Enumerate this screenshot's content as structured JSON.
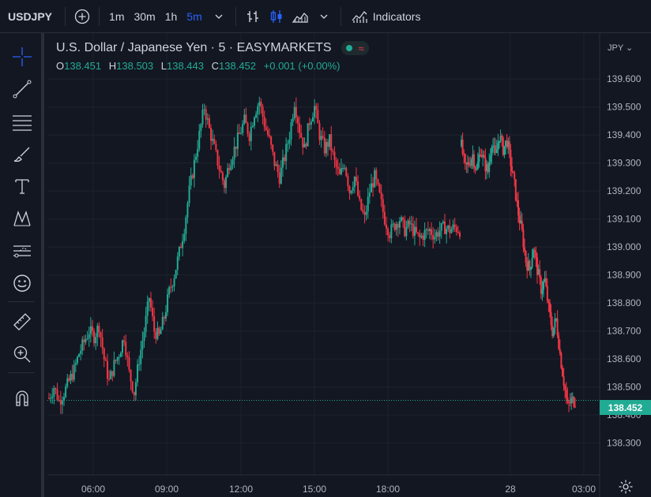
{
  "toolbar": {
    "symbol": "USDJPY",
    "intervals": [
      "1m",
      "30m",
      "1h",
      "5m"
    ],
    "active_interval": "5m",
    "indicators_label": "Indicators"
  },
  "left_tools": [
    "crosshair-icon",
    "trend-line-icon",
    "horizontal-lines-icon",
    "brush-icon",
    "text-icon",
    "pattern-icon",
    "prediction-icon",
    "emoji-icon",
    "ruler-icon",
    "zoom-in-icon",
    "magnet-icon"
  ],
  "legend": {
    "title": "U.S. Dollar / Japanese Yen · 5 · EASYMARKETS",
    "o_label": "O",
    "o_value": "138.451",
    "h_label": "H",
    "h_value": "138.503",
    "l_label": "L",
    "l_value": "138.443",
    "c_label": "C",
    "c_value": "138.452",
    "change": "+0.001 (+0.00%)"
  },
  "price_axis": {
    "currency": "JPY",
    "ticks": [
      "139.600",
      "139.500",
      "139.400",
      "139.300",
      "139.200",
      "139.100",
      "139.000",
      "138.900",
      "138.800",
      "138.700",
      "138.600",
      "138.500",
      "138.400",
      "138.300"
    ],
    "current_price": "138.452"
  },
  "time_axis": {
    "ticks": [
      "06:00",
      "09:00",
      "12:00",
      "15:00",
      "18:00",
      "28",
      "03:00"
    ]
  },
  "colors": {
    "up": "#22ab94",
    "down": "#f23645",
    "background": "#131722",
    "grid": "#1e222d",
    "accent": "#2962ff"
  },
  "chart_data": {
    "type": "candlestick",
    "symbol": "USDJPY",
    "timeframe": "5",
    "ylim": [
      138.25,
      139.65
    ],
    "y_ticks": [
      139.6,
      139.5,
      139.4,
      139.3,
      139.2,
      139.1,
      139.0,
      138.9,
      138.8,
      138.7,
      138.6,
      138.5,
      138.4,
      138.3
    ],
    "x_ticks": [
      "06:00",
      "09:00",
      "12:00",
      "15:00",
      "18:00",
      "28",
      "03:00"
    ],
    "segments": [
      {
        "session": "day1",
        "path": [
          [
            138.46,
            138.43
          ],
          [
            138.5,
            138.42
          ],
          [
            138.45,
            138.48
          ],
          [
            138.48,
            138.46
          ],
          [
            138.52,
            138.49
          ],
          [
            138.56,
            138.54
          ],
          [
            138.62,
            138.6
          ],
          [
            138.66,
            138.64
          ],
          [
            138.7,
            138.62
          ],
          [
            138.68,
            138.66
          ],
          [
            138.72,
            138.7
          ],
          [
            138.6,
            138.55
          ],
          [
            138.52,
            138.5
          ],
          [
            138.58,
            138.56
          ],
          [
            138.62,
            138.6
          ],
          [
            138.68,
            138.66
          ],
          [
            138.55,
            138.52
          ],
          [
            138.48,
            138.46
          ],
          [
            138.6,
            138.58
          ],
          [
            138.7,
            138.68
          ],
          [
            138.82,
            138.8
          ],
          [
            138.7,
            138.65
          ],
          [
            138.68,
            138.66
          ],
          [
            138.75,
            138.72
          ],
          [
            138.84,
            138.8
          ],
          [
            138.9,
            138.85
          ],
          [
            138.98,
            138.95
          ],
          [
            139.07,
            139.05
          ],
          [
            139.2,
            139.1
          ],
          [
            139.3,
            139.26
          ],
          [
            139.4,
            139.38
          ],
          [
            139.5,
            139.45
          ],
          [
            139.42,
            139.4
          ],
          [
            139.35,
            139.32
          ],
          [
            139.28,
            139.25
          ],
          [
            139.22,
            139.2
          ],
          [
            139.3,
            139.28
          ],
          [
            139.35,
            139.33
          ],
          [
            139.4,
            139.38
          ],
          [
            139.45,
            139.42
          ],
          [
            139.4,
            139.38
          ],
          [
            139.48,
            139.45
          ],
          [
            139.52,
            139.5
          ],
          [
            139.44,
            139.4
          ],
          [
            139.38,
            139.35
          ],
          [
            139.3,
            139.28
          ],
          [
            139.25,
            139.22
          ],
          [
            139.32,
            139.3
          ],
          [
            139.4,
            139.36
          ],
          [
            139.52,
            139.48
          ],
          [
            139.42,
            139.4
          ],
          [
            139.35,
            139.32
          ],
          [
            139.45,
            139.4
          ],
          [
            139.5,
            139.48
          ],
          [
            139.4,
            139.38
          ],
          [
            139.35,
            139.32
          ],
          [
            139.38,
            139.35
          ],
          [
            139.3,
            139.28
          ],
          [
            139.25,
            139.22
          ],
          [
            139.3,
            139.28
          ],
          [
            139.2,
            139.18
          ],
          [
            139.25,
            139.22
          ],
          [
            139.15,
            139.12
          ],
          [
            139.1,
            139.08
          ],
          [
            139.2,
            139.18
          ],
          [
            139.25,
            139.22
          ],
          [
            139.18,
            139.15
          ],
          [
            139.1,
            139.08
          ],
          [
            139.05,
            139.03
          ],
          [
            139.08,
            139.06
          ],
          [
            139.1,
            139.08
          ],
          [
            139.06,
            139.04
          ],
          [
            139.08,
            139.06
          ],
          [
            139.05,
            139.03
          ],
          [
            139.03,
            139.02
          ],
          [
            139.05,
            139.04
          ],
          [
            139.06,
            139.05
          ],
          [
            139.04,
            139.03
          ],
          [
            139.06,
            139.05
          ],
          [
            139.07,
            139.06
          ],
          [
            139.06,
            139.05
          ],
          [
            139.07,
            139.06
          ],
          [
            139.06,
            139.06
          ]
        ]
      },
      {
        "session": "day2",
        "path": [
          [
            139.36,
            139.35
          ],
          [
            139.28,
            139.27
          ],
          [
            139.3,
            139.28
          ],
          [
            139.33,
            139.31
          ],
          [
            139.27,
            139.28
          ],
          [
            139.35,
            139.33
          ],
          [
            139.3,
            139.29
          ],
          [
            139.27,
            139.28
          ],
          [
            139.38,
            139.36
          ],
          [
            139.32,
            139.3
          ],
          [
            139.4,
            139.38
          ],
          [
            139.35,
            139.33
          ],
          [
            139.38,
            139.36
          ],
          [
            139.3,
            139.28
          ],
          [
            139.22,
            139.2
          ],
          [
            139.12,
            139.1
          ],
          [
            139.05,
            139.02
          ],
          [
            138.95,
            138.9
          ],
          [
            138.92,
            138.9
          ],
          [
            139.0,
            138.98
          ],
          [
            138.92,
            138.9
          ],
          [
            138.85,
            138.82
          ],
          [
            138.88,
            138.86
          ],
          [
            138.78,
            138.75
          ],
          [
            138.7,
            138.68
          ],
          [
            138.74,
            138.72
          ],
          [
            138.62,
            138.6
          ],
          [
            138.52,
            138.45
          ],
          [
            138.43,
            138.42
          ],
          [
            138.45,
            138.44
          ],
          [
            138.452,
            138.452
          ]
        ]
      }
    ],
    "ohlc_last": {
      "open": 138.451,
      "high": 138.503,
      "low": 138.443,
      "close": 138.452
    },
    "last_price": 138.452
  }
}
